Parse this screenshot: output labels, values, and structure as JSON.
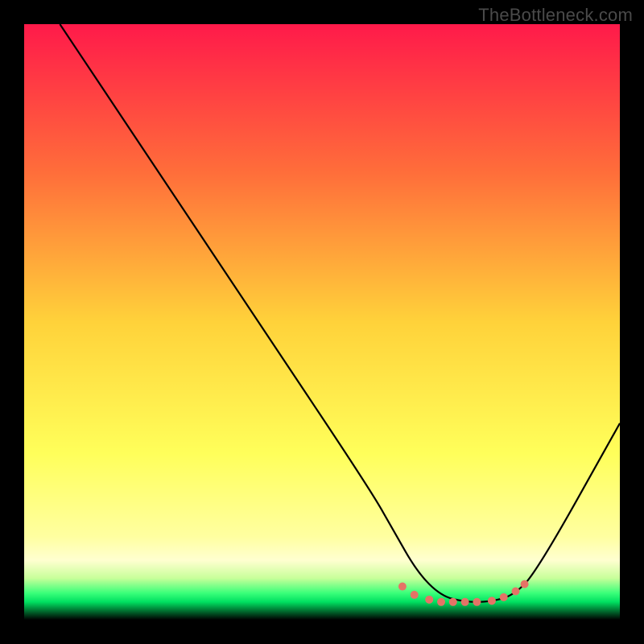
{
  "watermark": "TheBottleneck.com",
  "chart_data": {
    "type": "line",
    "title": "",
    "xlabel": "",
    "ylabel": "",
    "xlim": [
      0,
      100
    ],
    "ylim": [
      0,
      100
    ],
    "background_gradient": [
      {
        "offset": 0,
        "color": "#ff1a4a"
      },
      {
        "offset": 25,
        "color": "#ff6e3a"
      },
      {
        "offset": 50,
        "color": "#ffd23a"
      },
      {
        "offset": 72,
        "color": "#ffff5a"
      },
      {
        "offset": 86,
        "color": "#ffffa0"
      },
      {
        "offset": 90,
        "color": "#ffffd0"
      },
      {
        "offset": 93,
        "color": "#c8ff9a"
      },
      {
        "offset": 95.5,
        "color": "#3aff7a"
      },
      {
        "offset": 97,
        "color": "#00e060"
      },
      {
        "offset": 100,
        "color": "#000000"
      }
    ],
    "series": [
      {
        "name": "bottleneck-curve",
        "stroke": "#000000",
        "stroke_width": 2.2,
        "x": [
          6,
          12,
          22,
          40,
          58,
          62,
          66,
          70,
          74,
          78,
          82,
          86,
          100
        ],
        "y": [
          100,
          91,
          76,
          49,
          22,
          15,
          8,
          4,
          3,
          3,
          4,
          8,
          33
        ]
      }
    ],
    "markers": {
      "name": "highlight-band",
      "color": "#e57366",
      "radius": 5,
      "points": [
        {
          "x": 63.5,
          "y": 5.6
        },
        {
          "x": 65.5,
          "y": 4.2
        },
        {
          "x": 68.0,
          "y": 3.4
        },
        {
          "x": 70.0,
          "y": 3.0
        },
        {
          "x": 72.0,
          "y": 3.0
        },
        {
          "x": 74.0,
          "y": 3.0
        },
        {
          "x": 76.0,
          "y": 3.0
        },
        {
          "x": 78.5,
          "y": 3.2
        },
        {
          "x": 80.5,
          "y": 3.8
        },
        {
          "x": 82.5,
          "y": 4.8
        },
        {
          "x": 84.0,
          "y": 6.0
        }
      ]
    }
  }
}
